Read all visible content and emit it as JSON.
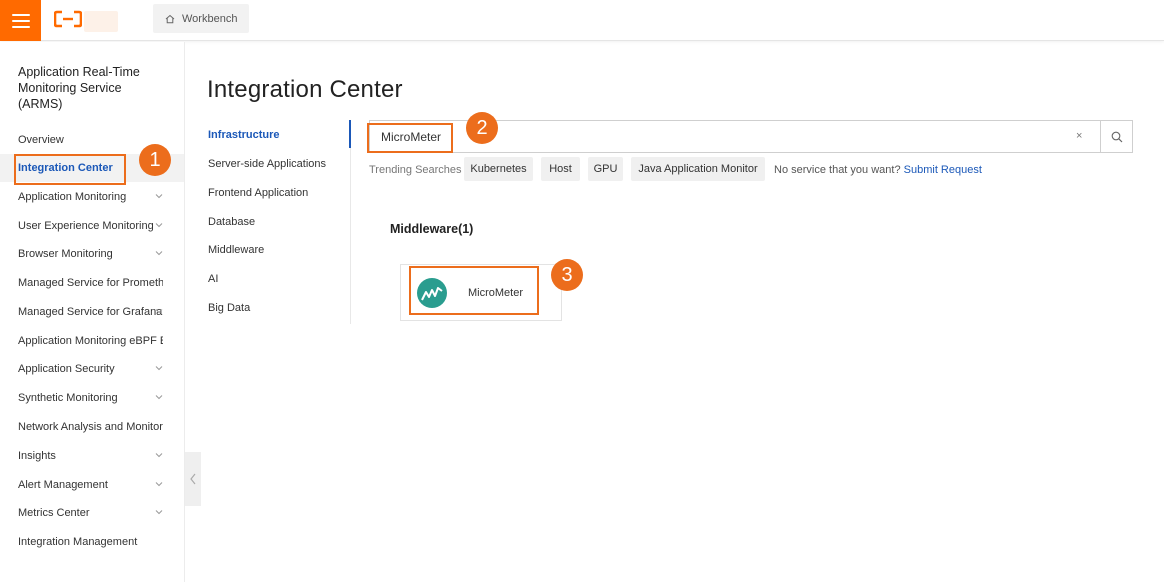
{
  "topbar": {
    "workbench_label": "Workbench",
    "accent": "#ff6a00"
  },
  "sidebar": {
    "title": "Application Real-Time Monitoring Service (ARMS)",
    "items": [
      {
        "label": "Overview",
        "chevron": false
      },
      {
        "label": "Integration Center",
        "chevron": false,
        "active": true
      },
      {
        "label": "Application Monitoring",
        "chevron": true
      },
      {
        "label": "User Experience Monitoring",
        "chevron": true
      },
      {
        "label": "Browser Monitoring",
        "chevron": true
      },
      {
        "label": "Managed Service for Prometheus",
        "chevron": false
      },
      {
        "label": "Managed Service for Grafana",
        "chevron": true
      },
      {
        "label": "Application Monitoring eBPF Edition",
        "chevron": false
      },
      {
        "label": "Application Security",
        "chevron": true
      },
      {
        "label": "Synthetic Monitoring",
        "chevron": true
      },
      {
        "label": "Network Analysis and Monitoring",
        "chevron": false
      },
      {
        "label": "Insights",
        "chevron": true
      },
      {
        "label": "Alert Management",
        "chevron": true
      },
      {
        "label": "Metrics Center",
        "chevron": true
      },
      {
        "label": "Integration Management",
        "chevron": false
      }
    ]
  },
  "main": {
    "title": "Integration Center",
    "categories": [
      {
        "label": "Infrastructure",
        "active": true
      },
      {
        "label": "Server-side Applications"
      },
      {
        "label": "Frontend Application"
      },
      {
        "label": "Database"
      },
      {
        "label": "Middleware"
      },
      {
        "label": "AI"
      },
      {
        "label": "Big Data"
      }
    ],
    "search": {
      "value": "MicroMeter",
      "clear_glyph": "×"
    },
    "trending_label": "Trending Searches",
    "trending": [
      "Kubernetes",
      "Host",
      "GPU",
      "Java Application Monitor"
    ],
    "no_service_text": "No service that you want?",
    "submit_request": "Submit Request",
    "section_title": "Middleware(1)",
    "card": {
      "label": "MicroMeter",
      "icon": "micrometer-icon",
      "icon_color": "#2a9d8f"
    }
  },
  "annotations": {
    "badge_1": "1",
    "badge_2": "2",
    "badge_3": "3",
    "color": "#ec6d1c"
  }
}
